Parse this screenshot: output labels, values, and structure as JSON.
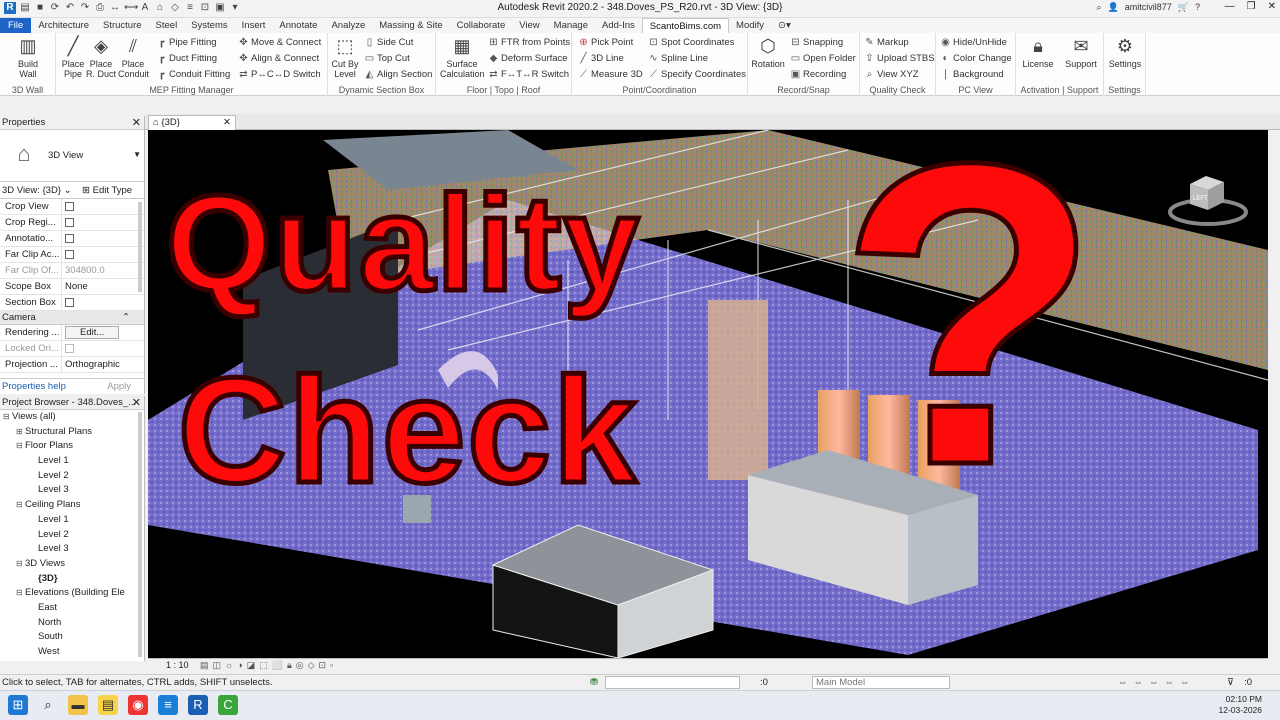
{
  "window": {
    "title": "Autodesk Revit 2020.2 - 348.Doves_PS_R20.rvt - 3D View: {3D}",
    "user": "amitcivil877"
  },
  "menu_tabs": [
    "File",
    "Architecture",
    "Structure",
    "Steel",
    "Systems",
    "Insert",
    "Annotate",
    "Analyze",
    "Massing & Site",
    "Collaborate",
    "View",
    "Manage",
    "Add-Ins",
    "ScantoBims.com",
    "Modify"
  ],
  "ribbon": {
    "build_wall": "Build Wall",
    "panel_3dwall": "3D Wall",
    "place_pipe": "Place Pipe",
    "place_rduct": "Place R. Duct",
    "place_conduit": "Place Conduit",
    "pipe_fitting": "Pipe Fitting",
    "duct_fitting": "Duct Fitting",
    "conduit_fitting": "Conduit Fitting",
    "move_connect": "Move & Connect",
    "align_connect": "Align & Connect",
    "pcd_switch": "P↔C↔D Switch",
    "panel_mep": "MEP Fitting Manager",
    "cut_by_level": "Cut By Level",
    "side_cut": "Side Cut",
    "top_cut": "Top Cut",
    "align_section": "Align Section",
    "panel_section": "Dynamic Section Box",
    "surface_calc": "Surface Calculation",
    "ftr_points": "FTR from Points",
    "deform_surface": "Deform Surface",
    "ftr_switch": "F↔T↔R Switch",
    "panel_floor": "Floor  |  Topo  |  Roof",
    "pick_point": "Pick Point",
    "line_3d": "3D Line",
    "measure_3d": "Measure 3D",
    "spot_coords": "Spot Coordinates",
    "spline_line": "Spline Line",
    "specify_coords": "Specify Coordinates",
    "panel_point": "Point/Coordination",
    "rotation": "Rotation",
    "snapping": "Snapping",
    "open_folder": "Open Folder",
    "recording": "Recording",
    "panel_record": "Record/Snap",
    "markup": "Markup",
    "upload_stbs": "Upload STBS",
    "view_xyz": "View XYZ",
    "panel_quality": "Quality Check",
    "hide_unhide": "Hide/UnHide",
    "color_change": "Color Change",
    "background": "Background",
    "panel_pcview": "PC View",
    "license": "License",
    "support": "Support",
    "panel_activation": "Activation | Support",
    "settings": "Settings",
    "panel_settings": "Settings"
  },
  "properties": {
    "header": "Properties",
    "type_name": "3D View",
    "instance": "3D View: {3D}",
    "edit_type": "Edit Type",
    "rows": [
      {
        "k": "Crop View",
        "v": "",
        "chk": true
      },
      {
        "k": "Crop Regi...",
        "v": "",
        "chk": true
      },
      {
        "k": "Annotatio...",
        "v": "",
        "chk": true
      },
      {
        "k": "Far Clip Ac...",
        "v": "",
        "chk": true
      },
      {
        "k": "Far Clip Of...",
        "v": "304800.0",
        "gray": true
      },
      {
        "k": "Scope Box",
        "v": "None"
      },
      {
        "k": "Section Box",
        "v": "",
        "chk": true
      }
    ],
    "group_camera": "Camera",
    "rendering": "Rendering ...",
    "rendering_btn": "Edit...",
    "locked": "Locked Ori...",
    "projection": "Projection ...",
    "projection_val": "Orthographic",
    "help": "Properties help",
    "apply": "Apply"
  },
  "browser": {
    "header": "Project Browser - 348.Doves_...",
    "nodes": [
      {
        "label": "Views (all)",
        "indent": 0,
        "tog": "⊟"
      },
      {
        "label": "Structural Plans",
        "indent": 1,
        "tog": "⊞"
      },
      {
        "label": "Floor Plans",
        "indent": 1,
        "tog": "⊟"
      },
      {
        "label": "Level 1",
        "indent": 2,
        "tog": ""
      },
      {
        "label": "Level 2",
        "indent": 2,
        "tog": ""
      },
      {
        "label": "Level 3",
        "indent": 2,
        "tog": ""
      },
      {
        "label": "Ceiling Plans",
        "indent": 1,
        "tog": "⊟"
      },
      {
        "label": "Level 1",
        "indent": 2,
        "tog": ""
      },
      {
        "label": "Level 2",
        "indent": 2,
        "tog": ""
      },
      {
        "label": "Level 3",
        "indent": 2,
        "tog": ""
      },
      {
        "label": "3D Views",
        "indent": 1,
        "tog": "⊟"
      },
      {
        "label": "{3D}",
        "indent": 2,
        "tog": "",
        "bold": true
      },
      {
        "label": "Elevations (Building Ele",
        "indent": 1,
        "tog": "⊟"
      },
      {
        "label": "East",
        "indent": 2,
        "tog": ""
      },
      {
        "label": "North",
        "indent": 2,
        "tog": ""
      },
      {
        "label": "South",
        "indent": 2,
        "tog": ""
      },
      {
        "label": "West",
        "indent": 2,
        "tog": ""
      }
    ]
  },
  "view": {
    "tab": "{3D}",
    "overlay_line1": "Quality",
    "overlay_line2": "Check",
    "overlay_mark": "?",
    "viewcube_face": "LEFT",
    "scale": "1 : 10"
  },
  "status": {
    "message": "Click to select, TAB for alternates, CTRL adds, SHIFT unselects.",
    "coord": ":0",
    "model": "Main Model",
    "filter": ":0"
  },
  "clock": {
    "time": "02:10 PM",
    "date": "12-03-2026"
  },
  "colors": {
    "accent": "#1e64c8",
    "overlay_red": "#ff0a0a"
  }
}
